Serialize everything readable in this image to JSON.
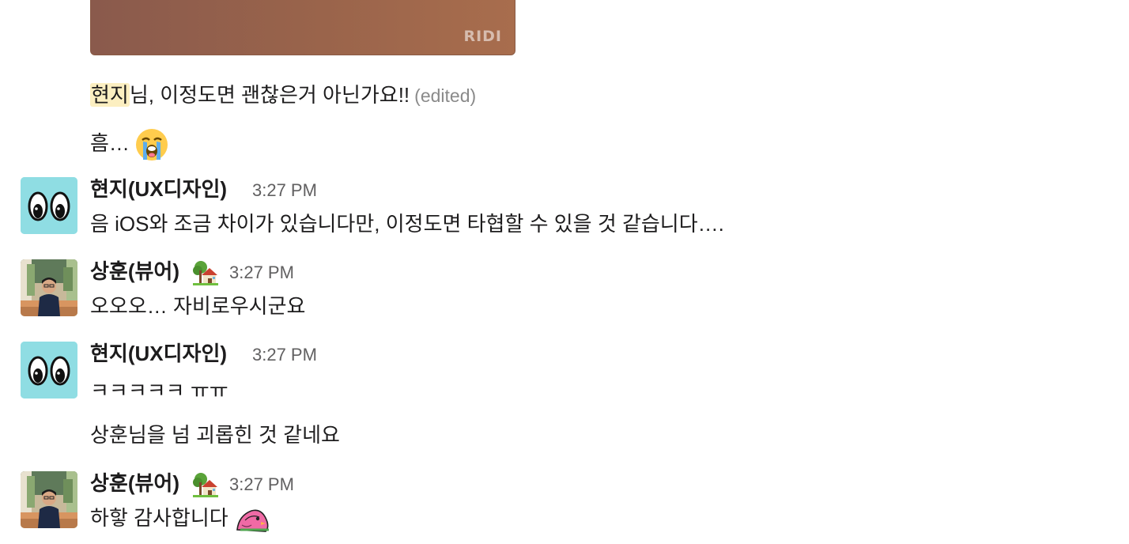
{
  "attachment": {
    "watermark": "RIDI"
  },
  "continuation_messages": {
    "first": {
      "mention": "현지",
      "text_after_mention": "님, 이정도면 괜찮은거 아닌가요!!",
      "edited": "(edited)"
    },
    "second": {
      "text": "흠…",
      "emoji": "loudly-crying-face"
    }
  },
  "messages": [
    {
      "author": "현지(UX디자인)",
      "time": "3:27 PM",
      "avatar": "eyes-icon",
      "lines": [
        "음 iOS와 조금 차이가 있습니다만, 이정도면 타협할 수 있을 것 같습니다…."
      ]
    },
    {
      "author": "상훈(뷰어)",
      "status_emoji": "house-with-garden",
      "time": "3:27 PM",
      "avatar": "photo-avatar",
      "lines": [
        "오오오… 자비로우시군요"
      ]
    },
    {
      "author": "현지(UX디자인)",
      "time": "3:27 PM",
      "avatar": "eyes-icon",
      "lines": [
        "ㅋㅋㅋㅋㅋ ㅠㅠ",
        "상훈님을 넘 괴롭힌 것 같네요"
      ]
    },
    {
      "author": "상훈(뷰어)",
      "status_emoji": "house-with-garden",
      "time": "3:27 PM",
      "avatar": "photo-avatar",
      "lines": [
        "하핳 감사합니다"
      ],
      "trailing_emoji": "pink-bird-custom-emoji"
    }
  ],
  "colors": {
    "mention_highlight": "#fcefc1",
    "eyes_avatar_bg": "#8fdde3",
    "timestamp": "#616061",
    "edited": "#8a8a8a"
  }
}
